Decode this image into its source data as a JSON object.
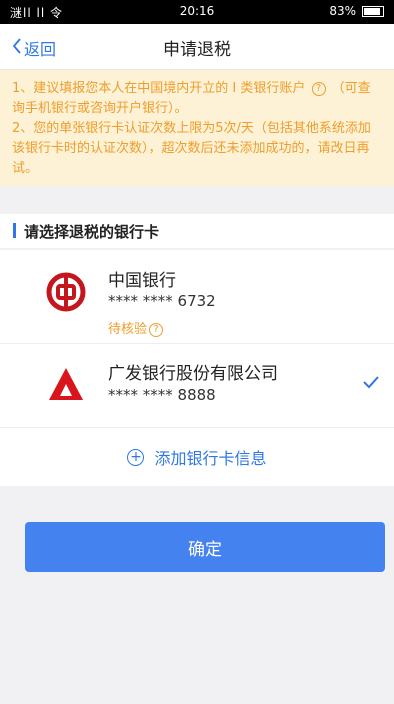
{
  "status_bar": {
    "signal_text": "㴹ll ll 令",
    "time": "20:16",
    "battery": "83%"
  },
  "nav": {
    "back_label": "返回",
    "title": "申请退税"
  },
  "notice": {
    "line1a": "1、建议填报您本人在中国境内开立的 I 类银行账户",
    "line1b": "（可查询手机银行或咨询开户银行）。",
    "line2": "2、您的单张银行卡认证次数上限为5次/天（包括其他系统添加该银行卡时的认证次数），超次数后还未添加成功的，请改日再试。"
  },
  "section": {
    "title": "请选择退税的银行卡"
  },
  "banks": [
    {
      "name": "中国银行",
      "number": "**** **** 6732",
      "status": "待核验",
      "selected": false,
      "logo_color": "#c4161c"
    },
    {
      "name": "广发银行股份有限公司",
      "number": "**** **** 8888",
      "status": "",
      "selected": true,
      "logo_color": "#d8141c"
    }
  ],
  "add_card": {
    "label": "添加银行卡信息"
  },
  "confirm": {
    "label": "确定"
  },
  "colors": {
    "accent": "#2f77e5",
    "warning": "#ef9d2b",
    "notice_bg": "#fdf2d6",
    "button": "#4483ef"
  }
}
